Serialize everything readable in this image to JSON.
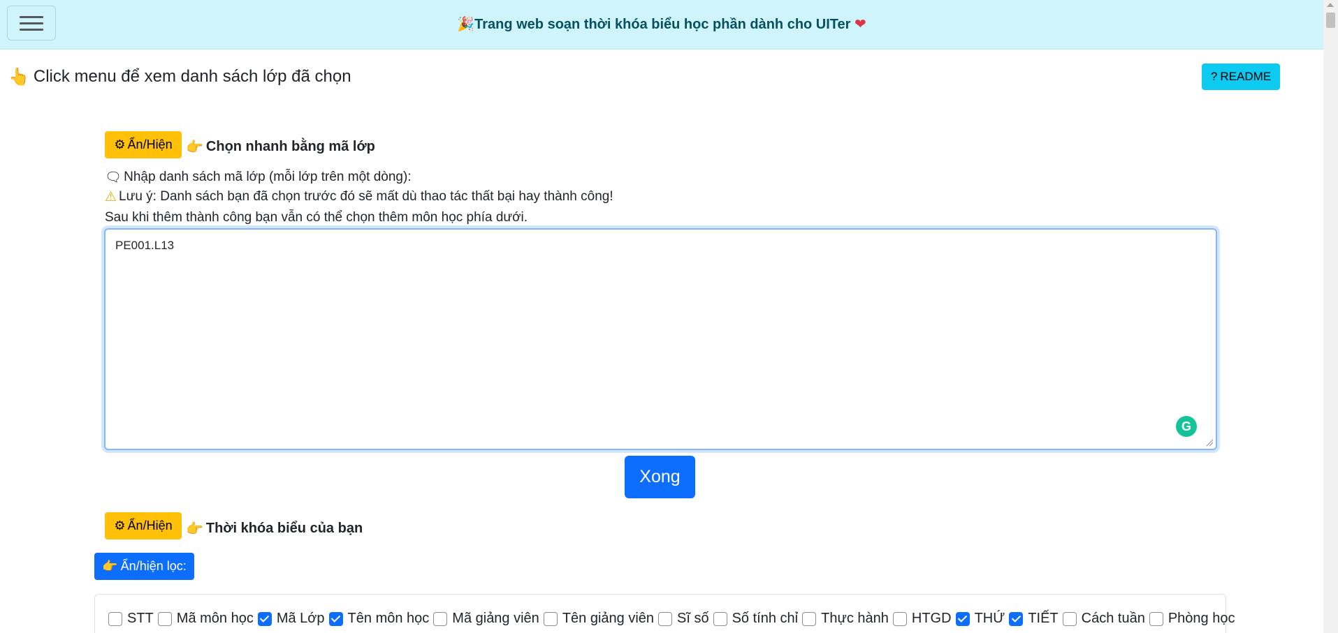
{
  "navbar": {
    "brand_icon": "🎉",
    "brand_text": "Trang web soạn thời khóa biểu học phần dành cho UITer",
    "brand_heart": "❤"
  },
  "hint": {
    "icon": "👆",
    "text": "Click menu để xem danh sách lớp đã chọn"
  },
  "readme": {
    "icon": "?",
    "label": "README"
  },
  "quick_select": {
    "toggle_icon": "⚙",
    "toggle_label": "Ẩn/Hiện",
    "title_icon": "👉",
    "title": "Chọn nhanh bằng mã lớp",
    "prompt_icon": "🗨",
    "prompt": "Nhập danh sách mã lớp (mỗi lớp trên một dòng):",
    "warning_icon": "⚠",
    "warning": "Lưu ý: Danh sách bạn đã chọn trước đó sẽ mất dù thao tác thất bại hay thành công!",
    "note": "Sau khi thêm thành công bạn vẫn có thể chọn thêm môn học phía dưới.",
    "textarea_value": "PE001.L13",
    "grammarly_letter": "G",
    "done_label": "Xong"
  },
  "schedule": {
    "toggle_icon": "⚙",
    "toggle_label": "Ẩn/Hiện",
    "title_icon": "👉",
    "title": "Thời khóa biểu của bạn",
    "filter_icon": "👉",
    "filter_label": "Ẩn/hiện lọc:"
  },
  "filters": [
    {
      "label": "STT",
      "checked": false
    },
    {
      "label": "Mã môn học",
      "checked": false
    },
    {
      "label": "Mã Lớp",
      "checked": true
    },
    {
      "label": "Tên môn học",
      "checked": true
    },
    {
      "label": "Mã giảng viên",
      "checked": false
    },
    {
      "label": "Tên giảng viên",
      "checked": false
    },
    {
      "label": "Sĩ số",
      "checked": false
    },
    {
      "label": "Số tính chỉ",
      "checked": false
    },
    {
      "label": "Thực hành",
      "checked": false
    },
    {
      "label": "HTGD",
      "checked": false
    },
    {
      "label": "THỨ",
      "checked": true
    },
    {
      "label": "TIẾT",
      "checked": true
    },
    {
      "label": "Cách tuần",
      "checked": false
    },
    {
      "label": "Phòng học",
      "checked": false
    }
  ]
}
